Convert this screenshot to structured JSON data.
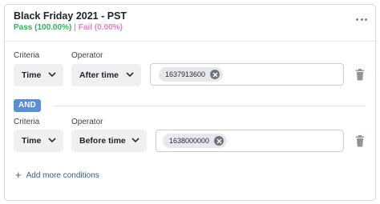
{
  "header": {
    "title": "Black Friday 2021 - PST",
    "pass": "Pass (100.00%)",
    "separator": "|",
    "fail": "Fail (0.00%)"
  },
  "conditions": [
    {
      "criteria_label": "Criteria",
      "operator_label": "Operator",
      "criteria": "Time",
      "operator": "After time",
      "value": "1637913600"
    },
    {
      "criteria_label": "Criteria",
      "operator_label": "Operator",
      "criteria": "Time",
      "operator": "Before time",
      "value": "1638000000"
    }
  ],
  "connector": "AND",
  "add_more": "Add more conditions",
  "colors": {
    "pass": "#31b25a",
    "fail": "#e77ec2",
    "and_badge": "#5a8fd6",
    "link": "#3a5a8c"
  },
  "icons": [
    "more-horizontal-icon",
    "chevron-down-icon",
    "remove-chip-icon",
    "trash-icon",
    "plus-icon"
  ]
}
